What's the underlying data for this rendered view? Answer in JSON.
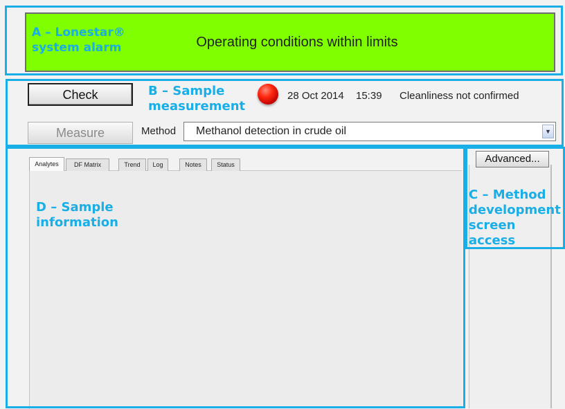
{
  "alarm": {
    "annotation": [
      "A – Lonestar®",
      "system alarm"
    ],
    "message": "Operating conditions within limits"
  },
  "measurement": {
    "annotation": [
      "B – Sample",
      "measurement"
    ],
    "check_label": "Check",
    "measure_label": "Measure",
    "date": "28 Oct 2014",
    "time": "15:39",
    "status": "Cleanliness not confirmed",
    "method_label": "Method",
    "method_value": "Methanol detection in crude oil"
  },
  "method_dev": {
    "annotation": [
      "C – Method",
      "development",
      "screen access"
    ],
    "advanced_label": "Advanced..."
  },
  "sample_info": {
    "annotation": [
      "D – Sample",
      "information"
    ],
    "tabs": [
      "Analytes",
      "DF Matrix",
      "Trend",
      "Log",
      "Notes",
      "Status"
    ]
  },
  "colors": {
    "annotation": "#1aaee6",
    "alarm_ok": "#7fff00",
    "status_led": "#e81a0a"
  },
  "icons": {
    "status_led": "red-led-icon",
    "select_arrow": "chevron-down-icon"
  }
}
